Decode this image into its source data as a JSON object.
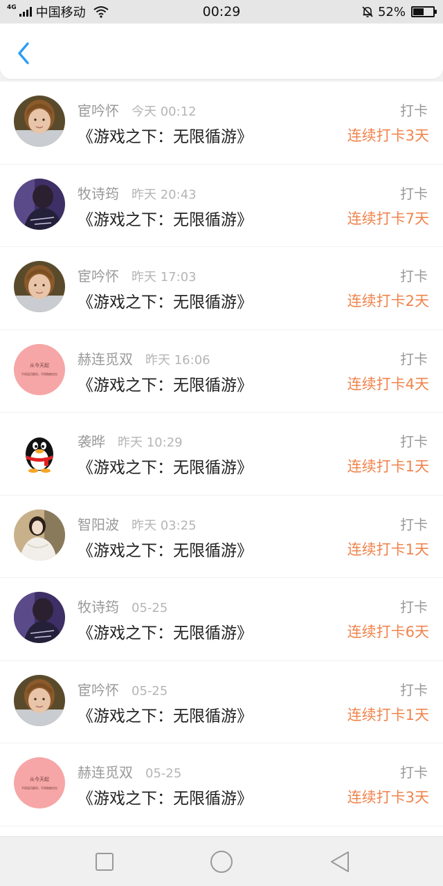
{
  "status_bar": {
    "network": "4G",
    "carrier": "中国移动",
    "time": "00:29",
    "battery_percent": "52%",
    "battery_level": 0.52,
    "icons": [
      "signal-icon",
      "wifi-icon",
      "mute-bell-icon",
      "battery-icon"
    ]
  },
  "header": {
    "back_icon": "chevron-left-icon",
    "accent_color": "#2a9df4"
  },
  "list": {
    "items": [
      {
        "name": "宦吟怀",
        "time": "今天 00:12",
        "title": "《游戏之下：无限循游》",
        "label": "打卡",
        "streak": "连续打卡3天",
        "avatar": "boy"
      },
      {
        "name": "牧诗筠",
        "time": "昨天 20:43",
        "title": "《游戏之下：无限循游》",
        "label": "打卡",
        "streak": "连续打卡7天",
        "avatar": "dark"
      },
      {
        "name": "宦吟怀",
        "time": "昨天 17:03",
        "title": "《游戏之下：无限循游》",
        "label": "打卡",
        "streak": "连续打卡2天",
        "avatar": "boy"
      },
      {
        "name": "赫连觅双",
        "time": "昨天 16:06",
        "title": "《游戏之下：无限循游》",
        "label": "打卡",
        "streak": "连续打卡4天",
        "avatar": "pink"
      },
      {
        "name": "袭晔",
        "time": "昨天 10:29",
        "title": "《游戏之下：无限循游》",
        "label": "打卡",
        "streak": "连续打卡1天",
        "avatar": "penguin"
      },
      {
        "name": "智阳波",
        "time": "昨天 03:25",
        "title": "《游戏之下：无限循游》",
        "label": "打卡",
        "streak": "连续打卡1天",
        "avatar": "girl"
      },
      {
        "name": "牧诗筠",
        "time": "05-25",
        "title": "《游戏之下：无限循游》",
        "label": "打卡",
        "streak": "连续打卡6天",
        "avatar": "dark"
      },
      {
        "name": "宦吟怀",
        "time": "05-25",
        "title": "《游戏之下：无限循游》",
        "label": "打卡",
        "streak": "连续打卡1天",
        "avatar": "boy"
      },
      {
        "name": "赫连觅双",
        "time": "05-25",
        "title": "《游戏之下：无限循游》",
        "label": "打卡",
        "streak": "连续打卡3天",
        "avatar": "pink"
      }
    ],
    "streak_color": "#f0834c"
  },
  "pink_avatar_text": {
    "line1": "从今天起",
    "line2": "不再盲目跟风，不再拖拖拉拉"
  },
  "navbar": {
    "icons": [
      "recent-apps-icon",
      "home-icon",
      "back-icon"
    ]
  }
}
